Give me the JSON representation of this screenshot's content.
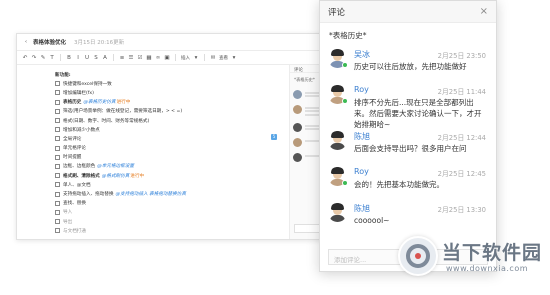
{
  "doc": {
    "title": "表格体验优化",
    "time": "3月15日 20:16更新",
    "toolbar_insert": "插入",
    "toolbar_view": "查看",
    "header": "新功能:",
    "rows": [
      {
        "text": "快捷键和excel保持一致",
        "style": ""
      },
      {
        "text": "增加编辑栏(fx)",
        "style": ""
      },
      {
        "text": "表格历史",
        "style": "bold",
        "tag": "@表格历史仿真",
        "tag2": "进行中"
      },
      {
        "text": "筛选(用户场景举例：做在线登记，需要筛选日期，> < =)",
        "style": ""
      },
      {
        "text": "格式(日期、数字、时间、财务等常规格式)",
        "style": ""
      },
      {
        "text": "增加和减少小数点",
        "style": ""
      },
      {
        "text": "全局评论",
        "style": ""
      },
      {
        "text": "单元格评论",
        "style": ""
      },
      {
        "text": "时间提醒",
        "style": ""
      },
      {
        "text": "边框、边框颜色",
        "style": "",
        "tag": "@单元格边框设置"
      },
      {
        "text": "格式刷、清除格式",
        "style": "bold",
        "tag": "@格式刷仿真",
        "tag2": "进行中"
      },
      {
        "text": "单人、@文档",
        "style": ""
      },
      {
        "text": "支持拖动插入、拖动替换",
        "style": "",
        "tag": "@支持拖动插入 表格拖动替换仿真"
      },
      {
        "text": "查找、替换",
        "style": ""
      },
      {
        "text": "导入",
        "style": "muted"
      },
      {
        "text": "导出",
        "style": "muted"
      },
      {
        "text": "与文档打通",
        "style": "muted"
      }
    ],
    "side_head": "评论",
    "side_quote": "*表格历史*"
  },
  "panel": {
    "title": "评论",
    "close": "×",
    "quote": "*表格历史*",
    "comments": [
      {
        "name": "吴冰",
        "time": "2月25日 23:50",
        "text": "历史可以往后放放，先把功能做好",
        "avatar_color": "#7d92b3",
        "online": true
      },
      {
        "name": "Roy",
        "time": "2月25日 11:44",
        "text": "排序不分先后...现在只是全部都列出来。然后需要大家讨论确认一下，才开始排期哈~",
        "avatar_color": "#c0a080",
        "online": true
      },
      {
        "name": "陈旭",
        "time": "2月25日 12:44",
        "text": "后面会支持导出吗？很多用户在问",
        "avatar_color": "#4a4a4a",
        "online": false
      },
      {
        "name": "Roy",
        "time": "2月25日 12:45",
        "text": "会的！先把基本功能做完。",
        "avatar_color": "#c0a080",
        "online": true
      },
      {
        "name": "陈旭",
        "time": "2月25日 13:30",
        "text": "coooool~",
        "avatar_color": "#4a4a4a",
        "online": false
      }
    ],
    "input_placeholder": "添加评论..."
  },
  "watermark": {
    "name": "当下软件园",
    "url": "www.downxia.com"
  }
}
